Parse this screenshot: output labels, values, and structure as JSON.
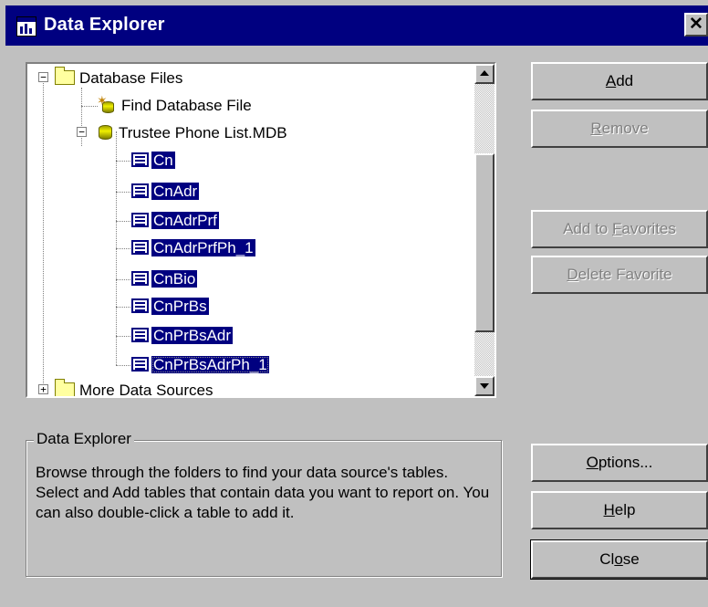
{
  "window": {
    "title": "Data Explorer",
    "close_glyph": "✕"
  },
  "tree": {
    "root": {
      "label": "Database Files",
      "expander": "−"
    },
    "find": {
      "label": "Find Database File"
    },
    "db": {
      "label": "Trustee Phone List.MDB",
      "expander": "−"
    },
    "tables": [
      {
        "label": "Cn"
      },
      {
        "label": "CnAdr"
      },
      {
        "label": "CnAdrPrf"
      },
      {
        "label": "CnAdrPrfPh_1"
      },
      {
        "label": "CnBio"
      },
      {
        "label": "CnPrBs"
      },
      {
        "label": "CnPrBsAdr"
      },
      {
        "label": "CnPrBsAdrPh_1"
      }
    ],
    "more": {
      "label": "More Data Sources",
      "expander": "+"
    }
  },
  "buttons": {
    "add": {
      "pre": "",
      "key": "A",
      "post": "dd"
    },
    "remove": {
      "pre": "",
      "key": "R",
      "post": "emove"
    },
    "add_favorites": {
      "pre": "Add to ",
      "key": "F",
      "post": "avorites"
    },
    "delete_favorite": {
      "pre": "",
      "key": "D",
      "post": "elete Favorite"
    },
    "options": {
      "pre": "",
      "key": "O",
      "post": "ptions..."
    },
    "help": {
      "pre": "",
      "key": "H",
      "post": "elp"
    },
    "close": {
      "pre": "Cl",
      "key": "o",
      "post": "se"
    }
  },
  "info": {
    "legend": "Data Explorer",
    "text": "Browse through the folders to find your data source's tables.  Select and Add tables that contain data you want to report on.  You can also double-click a table to add it."
  },
  "colors": {
    "titlebar": "#000080",
    "selection": "#000080",
    "face": "#c0c0c0"
  }
}
